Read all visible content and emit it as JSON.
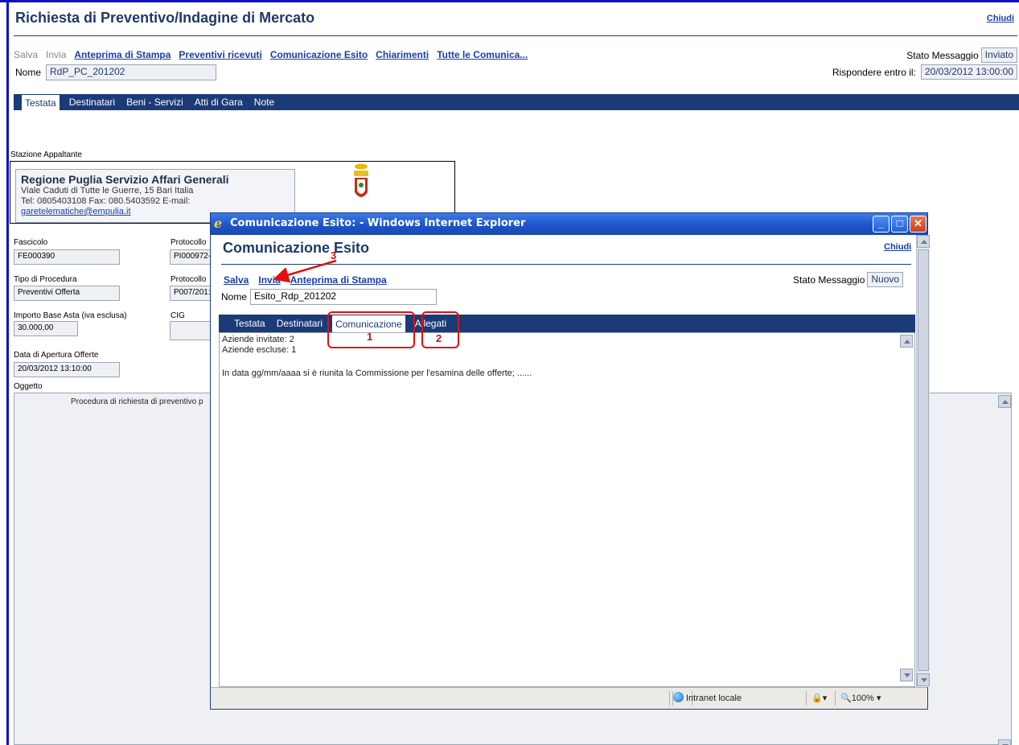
{
  "main": {
    "title": "Richiesta di Preventivo/Indagine di Mercato",
    "close_label": "Chiudi",
    "toolbar": {
      "salva": "Salva",
      "invia": "Invia",
      "links": [
        "Anteprima di Stampa",
        "Preventivi ricevuti",
        "Comunicazione Esito",
        "Chiarimenti",
        "Tutte le Comunica..."
      ]
    },
    "stato_label": "Stato Messaggio",
    "stato_value": "Inviato",
    "rispondere_label": "Rispondere entro il:",
    "rispondere_value": "20/03/2012 13:00:00",
    "nome_label": "Nome",
    "nome_value": "RdP_PC_201202",
    "tabs": [
      "Testata",
      "Destinatari",
      "Beni - Servizi",
      "Atti di Gara",
      "Note"
    ],
    "stazione_label": "Stazione Appaltante",
    "stazione": {
      "name": "Regione Puglia Servizio Affari Generali",
      "address": "Viale Caduti di Tutte le Guerre, 15 Bari Italia",
      "contacts": "Tel: 0805403108 Fax: 080.5403592 E-mail:",
      "email": "garetelematiche@empulia.it"
    },
    "fields": {
      "fascicolo_label": "Fascicolo",
      "fascicolo_value": "FE000390",
      "protocollo1_label": "Protocollo",
      "protocollo1_value": "PI000972-",
      "tipo_label": "Tipo di Procedura",
      "tipo_value": "Preventivi Offerta",
      "protocollo2_label": "Protocollo",
      "protocollo2_value": "P007/201:",
      "importo_label": "Importo Base Asta (iva esclusa)",
      "importo_value": "30.000,00",
      "cig_label": "CIG",
      "data_label": "Data di Apertura Offerte",
      "data_value": "20/03/2012 13:10:00",
      "oggetto_label": "Oggetto",
      "oggetto_value": "Procedura di richiesta di preventivo p"
    }
  },
  "popup": {
    "window_title": "Comunicazione Esito: - Windows Internet Explorer",
    "title": "Comunicazione Esito",
    "close_label": "Chiudi",
    "toolbar": {
      "salva": "Salva",
      "invia": "Invia",
      "anteprima": "Anteprima di Stampa"
    },
    "stato_label": "Stato Messaggio",
    "stato_value": "Nuovo",
    "nome_label": "Nome",
    "nome_value": "Esito_Rdp_201202",
    "tabs": [
      "Testata",
      "Destinatari",
      "Comunicazione",
      "Allegati"
    ],
    "content_lines": [
      "Aziende invitate: 2",
      "Aziende escluse: 1",
      "In data gg/mm/aaaa si è riunita la Commissione per l'esamina delle offerte; ......"
    ],
    "statusbar": {
      "zone": "Intranet locale",
      "zoom": "100%"
    }
  },
  "annotations": [
    "1",
    "2",
    "3"
  ],
  "colors": {
    "accent": "#1b3a78",
    "title": "#1f3a6a",
    "link": "#1a3da8",
    "highlight": "#e01010"
  }
}
